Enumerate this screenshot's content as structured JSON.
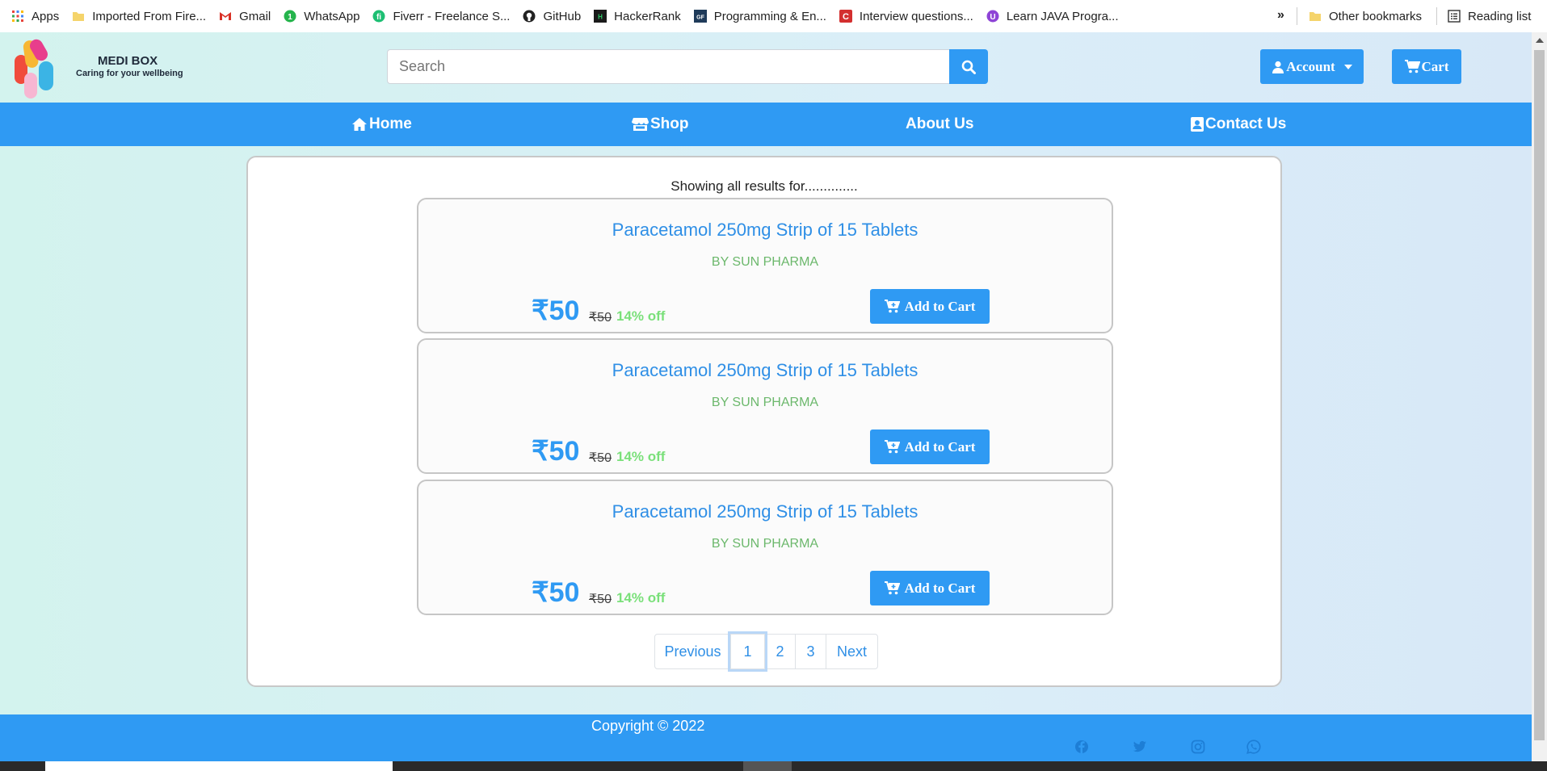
{
  "bookmarks": {
    "items": [
      {
        "label": "Apps",
        "icon": "apps-grid-icon"
      },
      {
        "label": "Imported From Fire...",
        "icon": "folder-icon"
      },
      {
        "label": "Gmail",
        "icon": "gmail-icon"
      },
      {
        "label": "WhatsApp",
        "icon": "whatsapp-icon"
      },
      {
        "label": "Fiverr - Freelance S...",
        "icon": "fiverr-icon"
      },
      {
        "label": "GitHub",
        "icon": "github-icon"
      },
      {
        "label": "HackerRank",
        "icon": "hackerrank-icon"
      },
      {
        "label": "Programming & En...",
        "icon": "gfg-icon"
      },
      {
        "label": "Interview questions...",
        "icon": "c-icon"
      },
      {
        "label": "Learn JAVA Progra...",
        "icon": "learn-icon"
      }
    ],
    "more": "»",
    "other_bookmarks": "Other bookmarks",
    "reading_list": "Reading list"
  },
  "header": {
    "brand_name": "MEDI BOX",
    "brand_tagline": "Caring for your wellbeing",
    "search_placeholder": "Search",
    "account_label": "Account",
    "cart_label": "Cart"
  },
  "nav": {
    "home": "Home",
    "shop": "Shop",
    "about": "About Us",
    "contact": "Contact Us"
  },
  "main": {
    "results_text": "Showing all results for..............",
    "products": [
      {
        "name": "Paracetamol 250mg Strip of 15 Tablets",
        "brand": "BY SUN PHARMA",
        "price": "₹50",
        "mrp": "₹50",
        "discount": "14% off",
        "button": "Add to Cart"
      },
      {
        "name": "Paracetamol 250mg Strip of 15 Tablets",
        "brand": "BY SUN PHARMA",
        "price": "₹50",
        "mrp": "₹50",
        "discount": "14% off",
        "button": "Add to Cart"
      },
      {
        "name": "Paracetamol 250mg Strip of 15 Tablets",
        "brand": "BY SUN PHARMA",
        "price": "₹50",
        "mrp": "₹50",
        "discount": "14% off",
        "button": "Add to Cart"
      }
    ],
    "pagination": {
      "previous": "Previous",
      "pages": [
        "1",
        "2",
        "3"
      ],
      "active_page": "1",
      "next": "Next"
    }
  },
  "footer": {
    "copyright": "Copyright © 2022",
    "social_icons": [
      "facebook-icon",
      "twitter-icon",
      "instagram-icon",
      "whatsapp-icon"
    ]
  },
  "colors": {
    "primary": "#2f9af3",
    "product_title": "#2f8fe6",
    "brand_text": "#6cb86c",
    "discount": "#7ae07a"
  }
}
